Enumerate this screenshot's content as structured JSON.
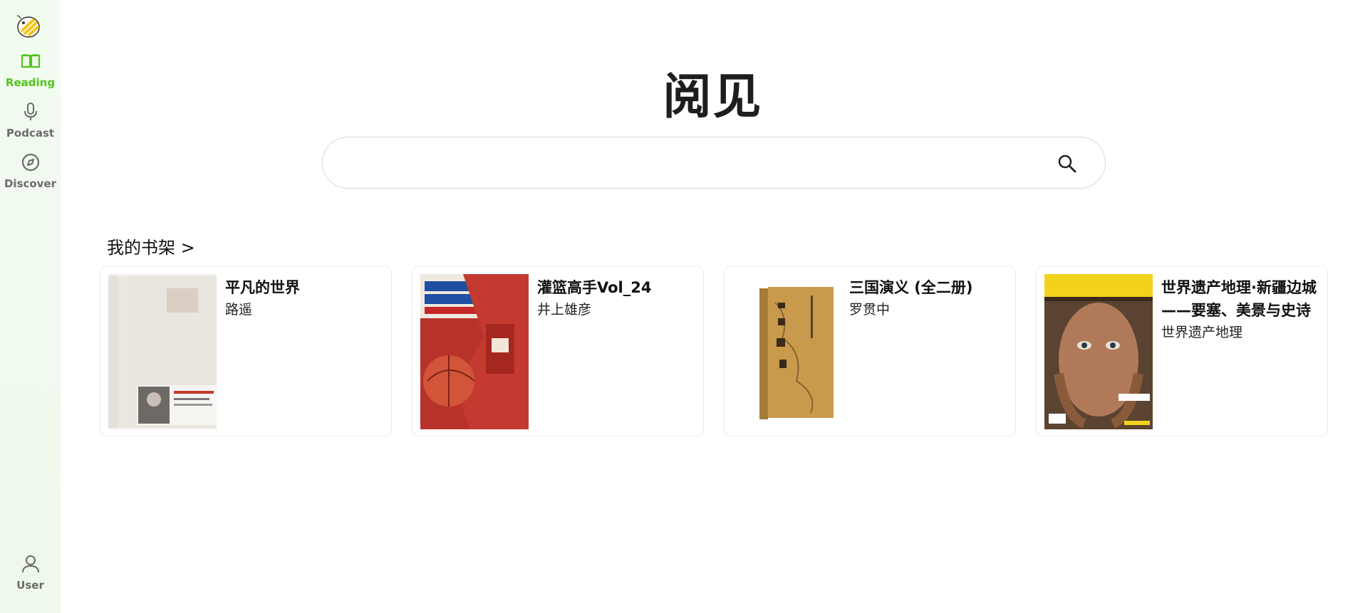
{
  "sidebar": {
    "logo_icon": "bee-logo-icon",
    "items": [
      {
        "label": "Reading",
        "icon": "book-open-icon",
        "active": true
      },
      {
        "label": "Podcast",
        "icon": "microphone-icon",
        "active": false
      },
      {
        "label": "Discover",
        "icon": "compass-icon",
        "active": false
      }
    ],
    "user": {
      "label": "User",
      "icon": "user-icon"
    },
    "accent_color": "#52c41a"
  },
  "main": {
    "title": "阅见",
    "search": {
      "placeholder": "",
      "value": "",
      "icon": "search-icon"
    },
    "shelf": {
      "header": "我的书架 >",
      "books": [
        {
          "title": "平凡的世界",
          "author": "路遥"
        },
        {
          "title": "灌篮高手Vol_24",
          "author": "井上雄彦"
        },
        {
          "title": "三国演义 (全二册)",
          "author": "罗贯中"
        },
        {
          "title": "世界遗产地理·新疆边城——要塞、美景与史诗",
          "author": "世界遗产地理"
        }
      ]
    }
  }
}
